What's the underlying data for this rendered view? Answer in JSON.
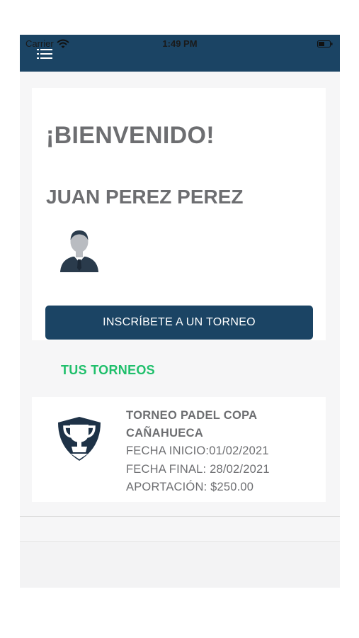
{
  "status_bar": {
    "carrier": "Carrier",
    "time": "1:49 PM"
  },
  "home": {
    "welcome": "¡BIENVENIDO!",
    "user_name": "JUAN PEREZ PEREZ",
    "enroll_button": "INSCRÍBETE A UN TORNEO"
  },
  "tournaments": {
    "section_title": "TUS TORNEOS",
    "items": [
      {
        "name_line1": "TORNEO PADEL COPA",
        "name_line2": "CAÑAHUECA",
        "start": "FECHA INICIO:01/02/2021",
        "end": "FECHA FINAL: 28/02/2021",
        "fee": "APORTACIÓN: $250.00"
      }
    ]
  },
  "icons": {
    "menu": "menu-icon",
    "wifi": "wifi-icon",
    "battery": "battery-icon",
    "avatar": "avatar-icon",
    "trophy": "trophy-shield-icon"
  },
  "colors": {
    "primary": "#1b4464",
    "accent": "#1fbf6b",
    "text": "#6d6e71",
    "background": "#f6f6f7"
  }
}
